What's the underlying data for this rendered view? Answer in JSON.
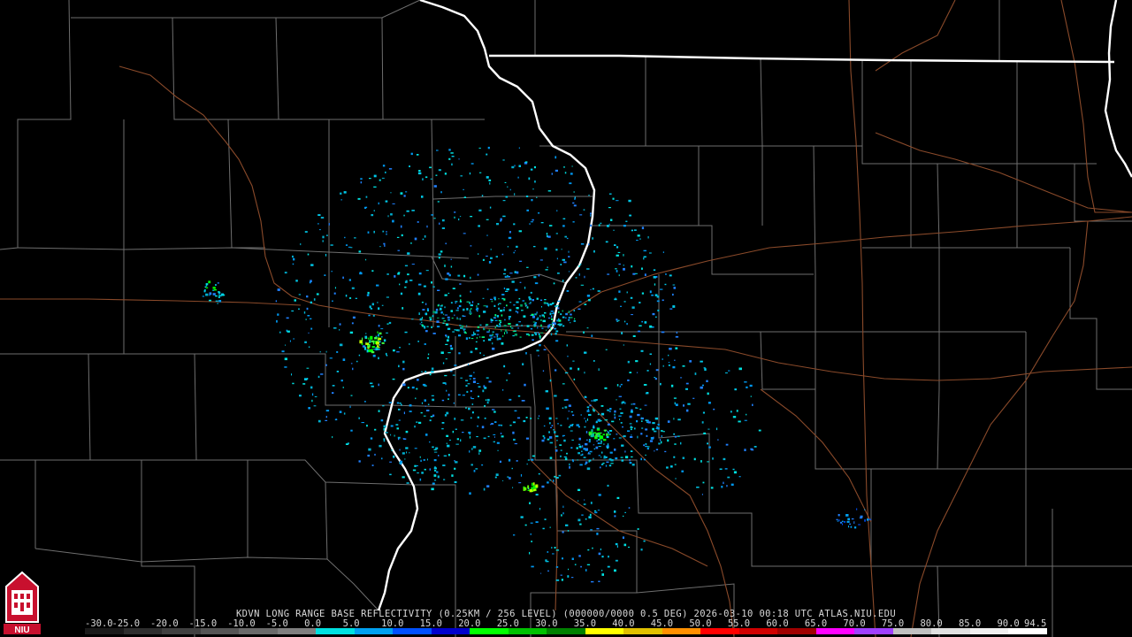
{
  "title": "KDVN LONG RANGE BASE REFLECTIVITY (0.25KM / 256 LEVEL) (000000/0000 0.5 DEG) 2026-03-10 00:18 UTC  ATLAS.NIU.EDU",
  "logo_text": "NIU",
  "scale": {
    "labels": [
      "-30.0",
      "-25.0",
      "-20.0",
      "-15.0",
      "-10.0",
      "-5.0",
      "0.0",
      "5.0",
      "10.0",
      "15.0",
      "20.0",
      "25.0",
      "30.0",
      "35.0",
      "40.0",
      "45.0",
      "50.0",
      "55.0",
      "60.0",
      "65.0",
      "70.0",
      "75.0",
      "80.0",
      "85.0",
      "90.0",
      "94.5"
    ],
    "colors": [
      "#1a1a1a",
      "#2e2e2e",
      "#404040",
      "#555555",
      "#6a6a6a",
      "#7f7f7f",
      "#00e0e0",
      "#00a0f0",
      "#0050ff",
      "#0000cc",
      "#00ff00",
      "#00c000",
      "#008000",
      "#ffff00",
      "#e0c000",
      "#ff9000",
      "#ff0000",
      "#d00000",
      "#a00000",
      "#ff00ff",
      "#a040ff",
      "#c0c0c0",
      "#e0e0e0",
      "#f0f0f0",
      "#ffffff"
    ]
  },
  "colors": {
    "background": "#000000",
    "county_lines": "#6e6e6e",
    "state_lines": "#ffffff",
    "highways": "#8a4a2a"
  }
}
